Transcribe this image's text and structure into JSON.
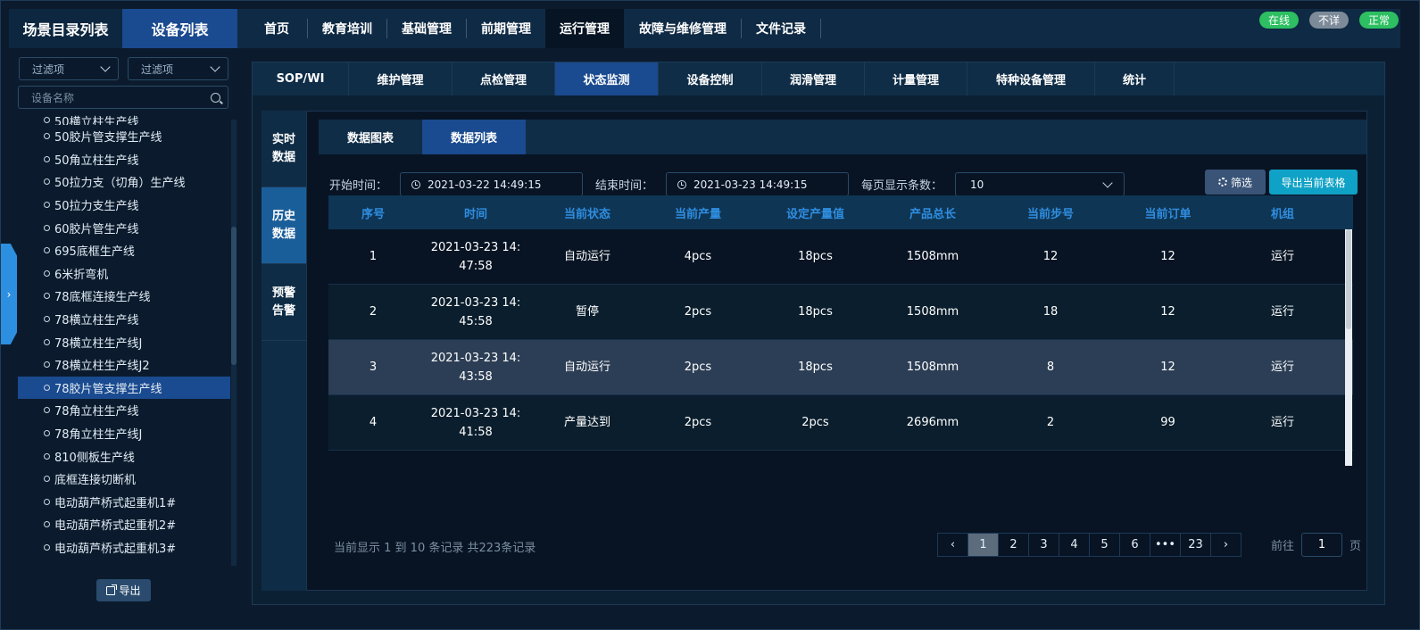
{
  "header": {
    "left_tabs": [
      "场景目录列表",
      "设备列表"
    ],
    "nav": [
      "首页",
      "教育培训",
      "基础管理",
      "前期管理",
      "运行管理",
      "故障与维修管理",
      "文件记录"
    ],
    "nav_active": 4,
    "badges": [
      {
        "label": "在线",
        "color": "#2dbf61"
      },
      {
        "label": "不详",
        "color": "#7d8b99"
      },
      {
        "label": "正常",
        "color": "#2dbf61"
      }
    ]
  },
  "sidebar": {
    "filter1": "过滤项",
    "filter2": "过滤项",
    "search_placeholder": "设备名称",
    "items": [
      "50横立柱生产线",
      "50胶片管支撑生产线",
      "50角立柱生产线",
      "50拉力支（切角）生产线",
      "50拉力支生产线",
      "60胶片管生产线",
      "695底框生产线",
      "6米折弯机",
      "78底框连接生产线",
      "78横立柱生产线",
      "78横立柱生产线J",
      "78横立柱生产线J2",
      "78胶片管支撑生产线",
      "78角立柱生产线",
      "78角立柱生产线J",
      "810侧板生产线",
      "底框连接切断机",
      "电动葫芦桥式起重机1#",
      "电动葫芦桥式起重机2#",
      "电动葫芦桥式起重机3#"
    ],
    "selected_index": 12,
    "export_label": "导出"
  },
  "subnav": {
    "items": [
      "SOP/WI",
      "维护管理",
      "点检管理",
      "状态监测",
      "设备控制",
      "润滑管理",
      "计量管理",
      "特种设备管理",
      "统计"
    ],
    "active": 3
  },
  "vtabs": {
    "items": [
      [
        "实时",
        "数据"
      ],
      [
        "历史",
        "数据"
      ],
      [
        "预警",
        "告警"
      ]
    ],
    "active": 1
  },
  "content_tabs": {
    "items": [
      "数据图表",
      "数据列表"
    ],
    "active": 1
  },
  "filters": {
    "start_label": "开始时间：",
    "start_value": "2021-03-22 14:49:15",
    "end_label": "结束时间：",
    "end_value": "2021-03-23 14:49:15",
    "page_size_label": "每页显示条数：",
    "page_size_value": "10",
    "filter_btn": "筛选",
    "export_btn": "导出当前表格"
  },
  "table": {
    "columns": [
      "序号",
      "时间",
      "当前状态",
      "当前产量",
      "设定产量值",
      "产品总长",
      "当前步号",
      "当前订单",
      "机组"
    ],
    "rows": [
      [
        "1",
        "2021-03-23 14:47:58",
        "自动运行",
        "4pcs",
        "18pcs",
        "1508mm",
        "12",
        "12",
        "运行"
      ],
      [
        "2",
        "2021-03-23 14:45:58",
        "暂停",
        "2pcs",
        "18pcs",
        "1508mm",
        "18",
        "12",
        "运行"
      ],
      [
        "3",
        "2021-03-23 14:43:58",
        "自动运行",
        "2pcs",
        "18pcs",
        "1508mm",
        "8",
        "12",
        "运行"
      ],
      [
        "4",
        "2021-03-23 14:41:58",
        "产量达到",
        "2pcs",
        "2pcs",
        "2696mm",
        "2",
        "99",
        "运行"
      ]
    ],
    "highlight_row": 2
  },
  "pagination": {
    "info": "当前显示 1 到 10 条记录 共223条记录",
    "pages": [
      "1",
      "2",
      "3",
      "4",
      "5",
      "6",
      "•••",
      "23"
    ],
    "active": "1",
    "goto_label": "前往",
    "goto_value": "1",
    "goto_suffix": "页"
  }
}
